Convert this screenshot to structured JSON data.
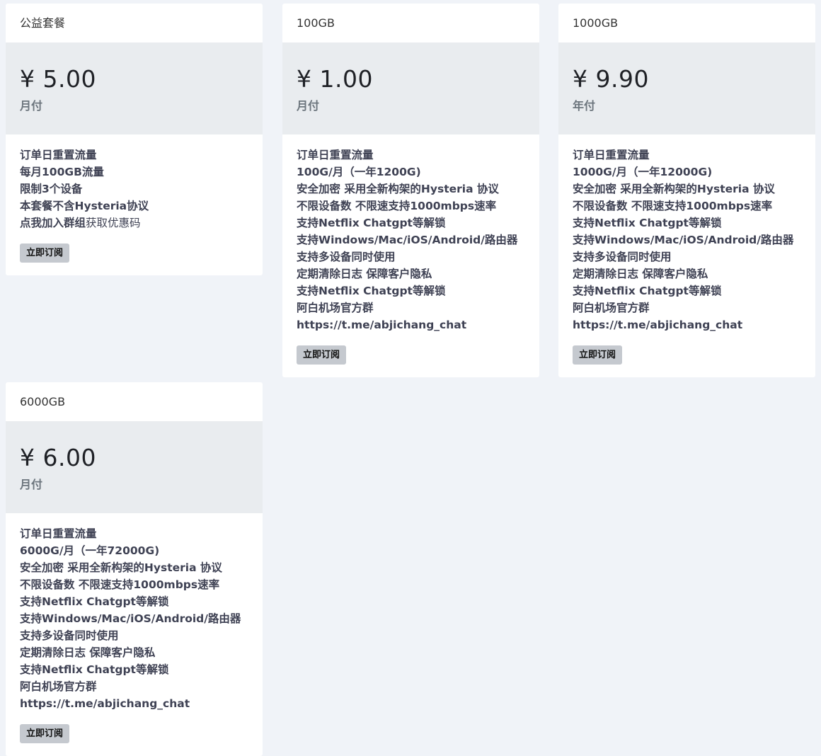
{
  "plans": [
    {
      "name": "公益套餐",
      "price": "¥ 5.00",
      "period": "月付",
      "features": [
        {
          "text": "订单日重置流量"
        },
        {
          "text": "每月100GB流量"
        },
        {
          "text": "限制3个设备"
        },
        {
          "text": "本套餐不含Hysteria协议"
        },
        {
          "text": "点我加入群组",
          "suffix": "获取优惠码"
        }
      ],
      "button": "立即订阅"
    },
    {
      "name": "100GB",
      "price": "¥ 1.00",
      "period": "月付",
      "features": [
        {
          "text": "订单日重置流量"
        },
        {
          "text": "100G/月（一年1200G)"
        },
        {
          "text": "安全加密 采用全新构架的Hysteria 协议"
        },
        {
          "text": "不限设备数 不限速支持1000mbps速率"
        },
        {
          "text": "支持Netflix Chatgpt等解锁"
        },
        {
          "text": "支持Windows/Mac/iOS/Android/路由器 支持多设备同时使用"
        },
        {
          "text": "定期清除日志 保障客户隐私"
        },
        {
          "text": "支持Netflix Chatgpt等解锁"
        },
        {
          "text": "阿白机场官方群https://t.me/abjichang_chat"
        }
      ],
      "button": "立即订阅"
    },
    {
      "name": "1000GB",
      "price": "¥ 9.90",
      "period": "年付",
      "features": [
        {
          "text": "订单日重置流量"
        },
        {
          "text": "1000G/月（一年12000G)"
        },
        {
          "text": "安全加密 采用全新构架的Hysteria 协议"
        },
        {
          "text": "不限设备数 不限速支持1000mbps速率"
        },
        {
          "text": "支持Netflix Chatgpt等解锁"
        },
        {
          "text": "支持Windows/Mac/iOS/Android/路由器 支持多设备同时使用"
        },
        {
          "text": "定期清除日志 保障客户隐私"
        },
        {
          "text": "支持Netflix Chatgpt等解锁"
        },
        {
          "text": "阿白机场官方群https://t.me/abjichang_chat"
        }
      ],
      "button": "立即订阅"
    },
    {
      "name": "6000GB",
      "price": "¥ 6.00",
      "period": "月付",
      "features": [
        {
          "text": "订单日重置流量"
        },
        {
          "text": "6000G/月（一年72000G)"
        },
        {
          "text": "安全加密 采用全新构架的Hysteria 协议"
        },
        {
          "text": "不限设备数 不限速支持1000mbps速率"
        },
        {
          "text": "支持Netflix Chatgpt等解锁"
        },
        {
          "text": "支持Windows/Mac/iOS/Android/路由器 支持多设备同时使用"
        },
        {
          "text": "定期清除日志 保障客户隐私"
        },
        {
          "text": "支持Netflix Chatgpt等解锁"
        },
        {
          "text": "阿白机场官方群https://t.me/abjichang_chat"
        }
      ],
      "button": "立即订阅"
    }
  ]
}
